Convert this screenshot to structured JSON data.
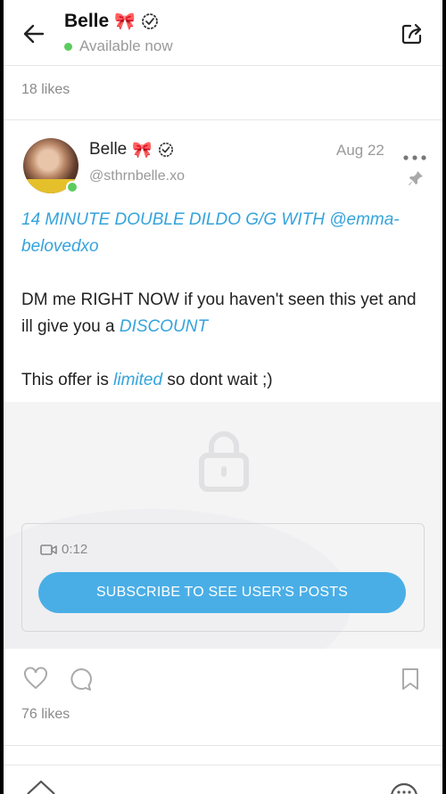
{
  "header": {
    "name": "Belle",
    "name_emoji": "🎀",
    "status": "Available now",
    "icons": {
      "back": "back-arrow-icon",
      "share": "share-icon",
      "verified": "verified-icon"
    }
  },
  "post": {
    "likes_top": "18 likes",
    "author": {
      "name": "Belle",
      "emoji": "🎀",
      "handle": "@sthrnbelle.xo"
    },
    "date": "Aug 22",
    "caption": {
      "title": "14 MINUTE DOUBLE DILDO G/G WITH @emma-belovedxo",
      "dm_prefix": "DM me RIGHT NOW if you haven't seen this yet and ill give you a ",
      "dm_highlight": "DISCOUNT",
      "offer_prefix": "This offer is ",
      "offer_highlight": "limited",
      "offer_suffix": " so dont wait ;)"
    },
    "media": {
      "duration": "0:12",
      "subscribe_label": "SUBSCRIBE TO SEE USER'S POSTS"
    },
    "likes_bottom": "76 likes"
  },
  "colors": {
    "accent": "#4aaee6",
    "highlight": "#35a3dc",
    "online": "#5ccb5f"
  }
}
